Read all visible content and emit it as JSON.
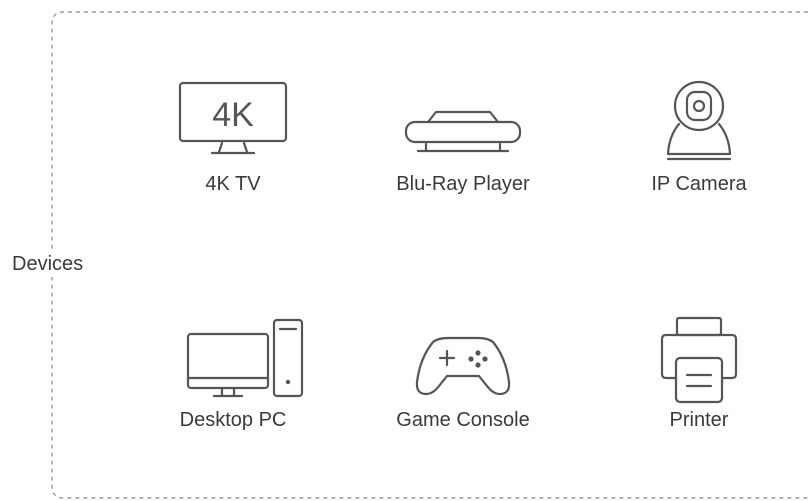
{
  "group_label": "Devices",
  "devices": [
    {
      "label": "4K TV",
      "icon": "tv-icon",
      "icon_text": "4K"
    },
    {
      "label": "Blu-Ray Player",
      "icon": "bluray-player-icon"
    },
    {
      "label": "IP Camera",
      "icon": "ip-camera-icon"
    },
    {
      "label": "Desktop PC",
      "icon": "desktop-pc-icon"
    },
    {
      "label": "Game Console",
      "icon": "gamepad-icon"
    },
    {
      "label": "Printer",
      "icon": "printer-icon"
    }
  ],
  "colors": {
    "stroke": "#555555",
    "border": "#999999",
    "text": "#3a3a3a"
  }
}
